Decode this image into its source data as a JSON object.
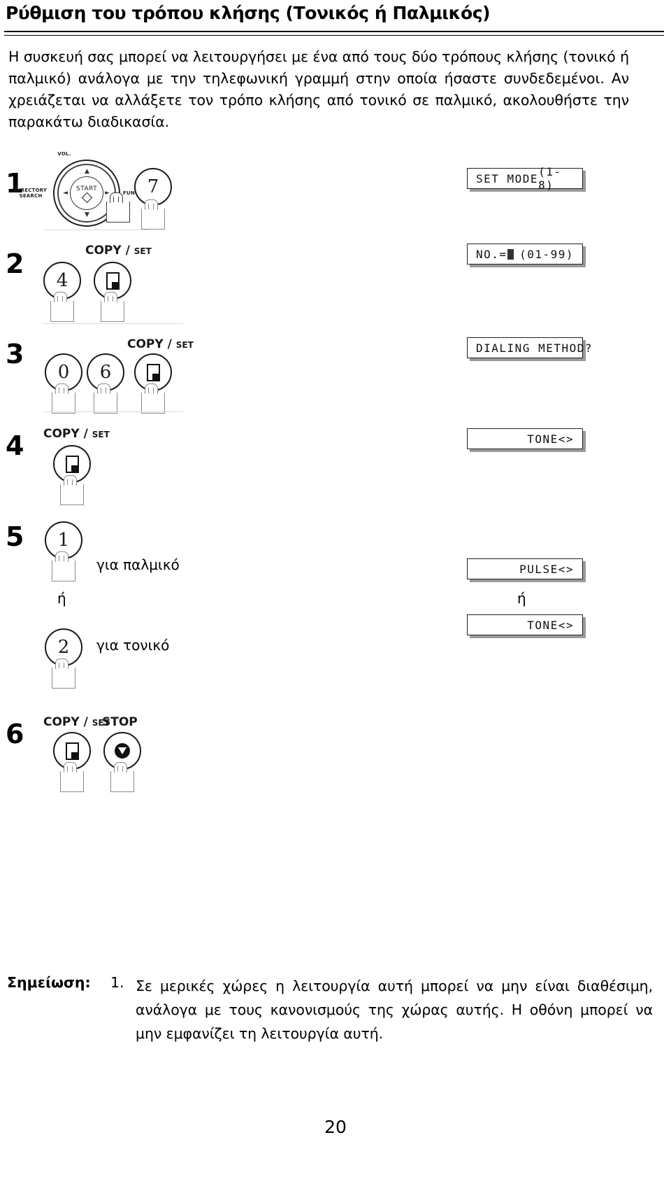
{
  "document": {
    "heading": "Ρύθμιση του τρόπου κλήσης (Τονικός ή Παλμικός)",
    "intro": "Η συσκευή σας μπορεί να λειτουργήσει με ένα από τους δύο τρόπους κλήσης (τονικό ή παλμικό) ανάλογα με την τηλεφωνική γραμμή στην οποία ήσαστε συνδεδεμένοι.  Αν χρειάζεται να αλλάξετε τον τρόπο κλήσης από τονικό σε παλμικό, ακολουθήστε την παρακάτω διαδικασία.",
    "page_number": "20"
  },
  "dial": {
    "vol_label": "VOL.",
    "directory_label": "DIRECTORY SEARCH",
    "function_label": "FUNCTION",
    "start_label": "START",
    "up_arrow": "▲",
    "down_arrow": "▼",
    "left_arrow": "◄",
    "right_arrow": "►"
  },
  "steps": [
    {
      "num": "1",
      "keys": [
        "FUNCTION",
        "7"
      ],
      "key_labels": [],
      "display": {
        "left": "SET MODE",
        "right": "(1-8)",
        "align": "split"
      }
    },
    {
      "num": "2",
      "keys": [
        "4",
        "COPY/SET"
      ],
      "key_labels": [
        {
          "big": "COPY",
          "slash": " / ",
          "sm": "SET"
        }
      ],
      "display": {
        "left": "NO.=",
        "cursor": true,
        "right": "(01-99)",
        "align": "split"
      }
    },
    {
      "num": "3",
      "keys": [
        "0",
        "6",
        "COPY/SET"
      ],
      "key_labels": [
        {
          "big": "COPY",
          "slash": " / ",
          "sm": "SET"
        }
      ],
      "display": {
        "left": "DIALING METHOD?",
        "right": "",
        "align": "left"
      }
    },
    {
      "num": "4",
      "keys": [
        "COPY/SET"
      ],
      "key_labels": [
        {
          "big": "COPY",
          "slash": " / ",
          "sm": "SET"
        }
      ],
      "display": {
        "left": "",
        "right": "TONE<>",
        "align": "right"
      }
    },
    {
      "num": "5",
      "keys": [
        "1",
        "2"
      ],
      "key_labels": [],
      "captions": {
        "pulse": "για παλμικό",
        "or_left": "ή",
        "tone": "για τονικό",
        "or_right": "ή"
      },
      "displays": [
        {
          "right": "PULSE<>",
          "align": "right"
        },
        {
          "right": "TONE<>",
          "align": "right"
        }
      ]
    },
    {
      "num": "6",
      "keys": [
        "COPY/SET",
        "STOP"
      ],
      "key_labels": [
        {
          "big": "COPY",
          "slash": " / ",
          "sm": "SET"
        },
        {
          "big": "STOP",
          "slash": "",
          "sm": ""
        }
      ],
      "display": null
    }
  ],
  "note": {
    "label": "Σημείωση:",
    "index": "1.",
    "body": "Σε μερικές χώρες η λειτουργία αυτή μπορεί να μην είναι διαθέσιμη, ανάλογα με τους κανονισμούς της χώρας αυτής.  Η οθόνη μπορεί να μην εμφανίζει τη λειτουργία αυτή."
  }
}
